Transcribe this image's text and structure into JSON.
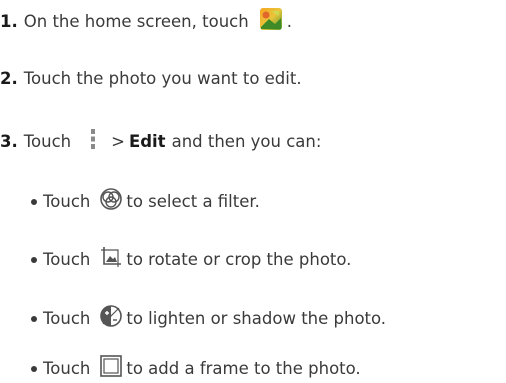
{
  "steps": [
    {
      "num": "1.",
      "pre": "On the home screen, touch",
      "post": "."
    },
    {
      "num": "2.",
      "text": "Touch the photo you want to edit."
    },
    {
      "num": "3.",
      "pre": "Touch",
      "gt": ">",
      "bold": "Edit",
      "post": "and then you can:"
    }
  ],
  "bullets": [
    {
      "pre": "Touch",
      "post": "to select a filter."
    },
    {
      "pre": "Touch",
      "post": "to rotate or crop the photo."
    },
    {
      "pre": "Touch",
      "post": "to lighten or shadow the photo."
    },
    {
      "pre": "Touch",
      "post": "to add a frame to the photo."
    }
  ],
  "icons": {
    "gallery": "gallery-app-icon",
    "menu": "menu-more-icon",
    "filter": "filter-icon",
    "crop": "rotate-crop-icon",
    "light": "lighten-shadow-icon",
    "frame": "frame-icon"
  }
}
